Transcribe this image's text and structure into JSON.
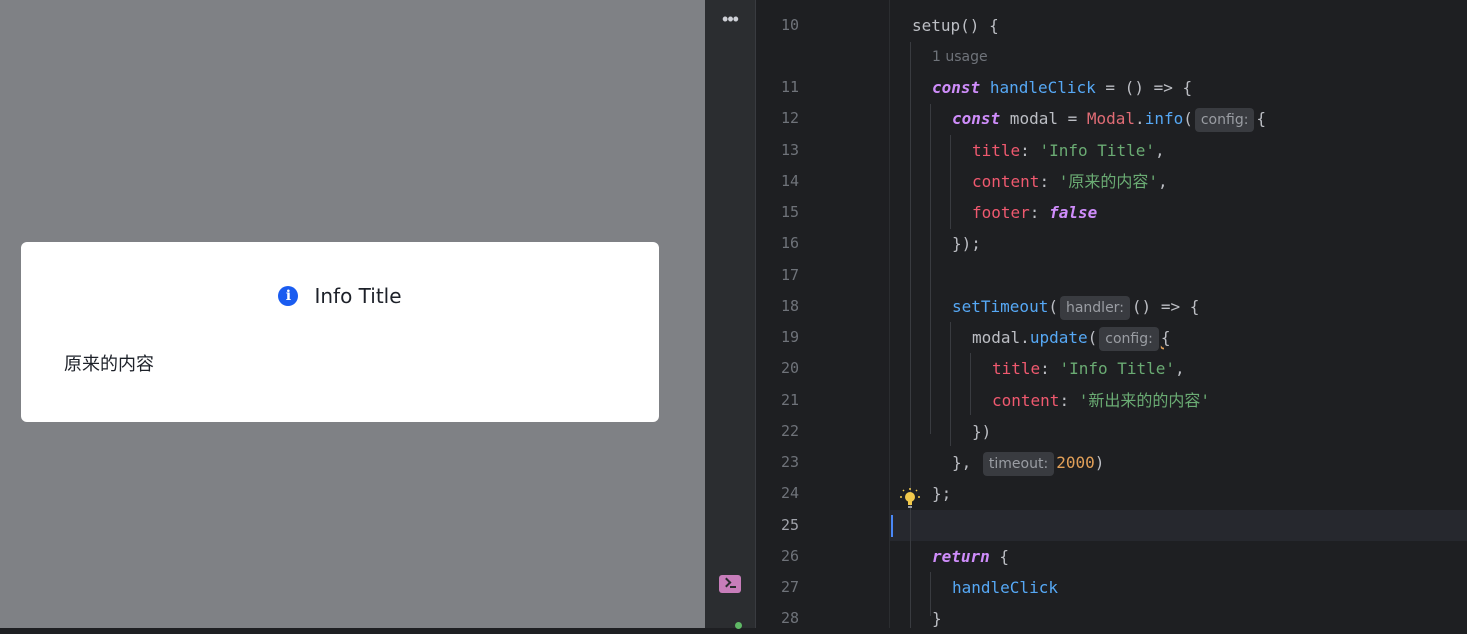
{
  "modal": {
    "icon_glyph": "i",
    "title": "Info Title",
    "content": "原来的内容"
  },
  "ide": {
    "icons": [
      "more-icon",
      "terminal-icon",
      "lightbulb-icon"
    ],
    "usage_hint": "1 usage",
    "current_line": 25,
    "line_numbers": [
      "10",
      "11",
      "12",
      "13",
      "14",
      "15",
      "16",
      "17",
      "18",
      "19",
      "20",
      "21",
      "22",
      "23",
      "24",
      "25",
      "26",
      "27",
      "28"
    ],
    "code": {
      "l10": {
        "a": "setup",
        "b": "() {"
      },
      "l11": {
        "kw": "const",
        "name": "handleClick",
        "rest": " = () => {"
      },
      "l12": {
        "kw": "const",
        "var": " modal = ",
        "cls": "Modal",
        "dot": ".",
        "fn": "info",
        "paren": "(",
        "hint": "config:",
        "brace": "{"
      },
      "l13": {
        "prop": "title",
        "colon": ": ",
        "str": "'Info Title'",
        "comma": ","
      },
      "l14": {
        "prop": "content",
        "colon": ": ",
        "str": "'原来的内容'",
        "comma": ","
      },
      "l15": {
        "prop": "footer",
        "colon": ": ",
        "kw": "false"
      },
      "l16": {
        "text": "});"
      },
      "l18": {
        "fn": "setTimeout",
        "paren": "(",
        "hint": "handler:",
        "rest": "() => {"
      },
      "l19": {
        "var": "modal",
        "dot": ".",
        "fn": "update",
        "paren": "(",
        "hint": "config:",
        "brace": "{"
      },
      "l20": {
        "prop": "title",
        "colon": ": ",
        "str": "'Info Title'",
        "comma": ","
      },
      "l21": {
        "prop": "content",
        "colon": ": ",
        "str": "'新出来的的内容'"
      },
      "l22": {
        "text": "})"
      },
      "l23": {
        "a": "},",
        "hint": "timeout:",
        "num": "2000",
        "b": ")"
      },
      "l24": {
        "text": "};"
      },
      "l26": {
        "kw": "return",
        "rest": " {"
      },
      "l27": {
        "fn": "handleClick"
      },
      "l28": {
        "text": "}"
      }
    }
  }
}
